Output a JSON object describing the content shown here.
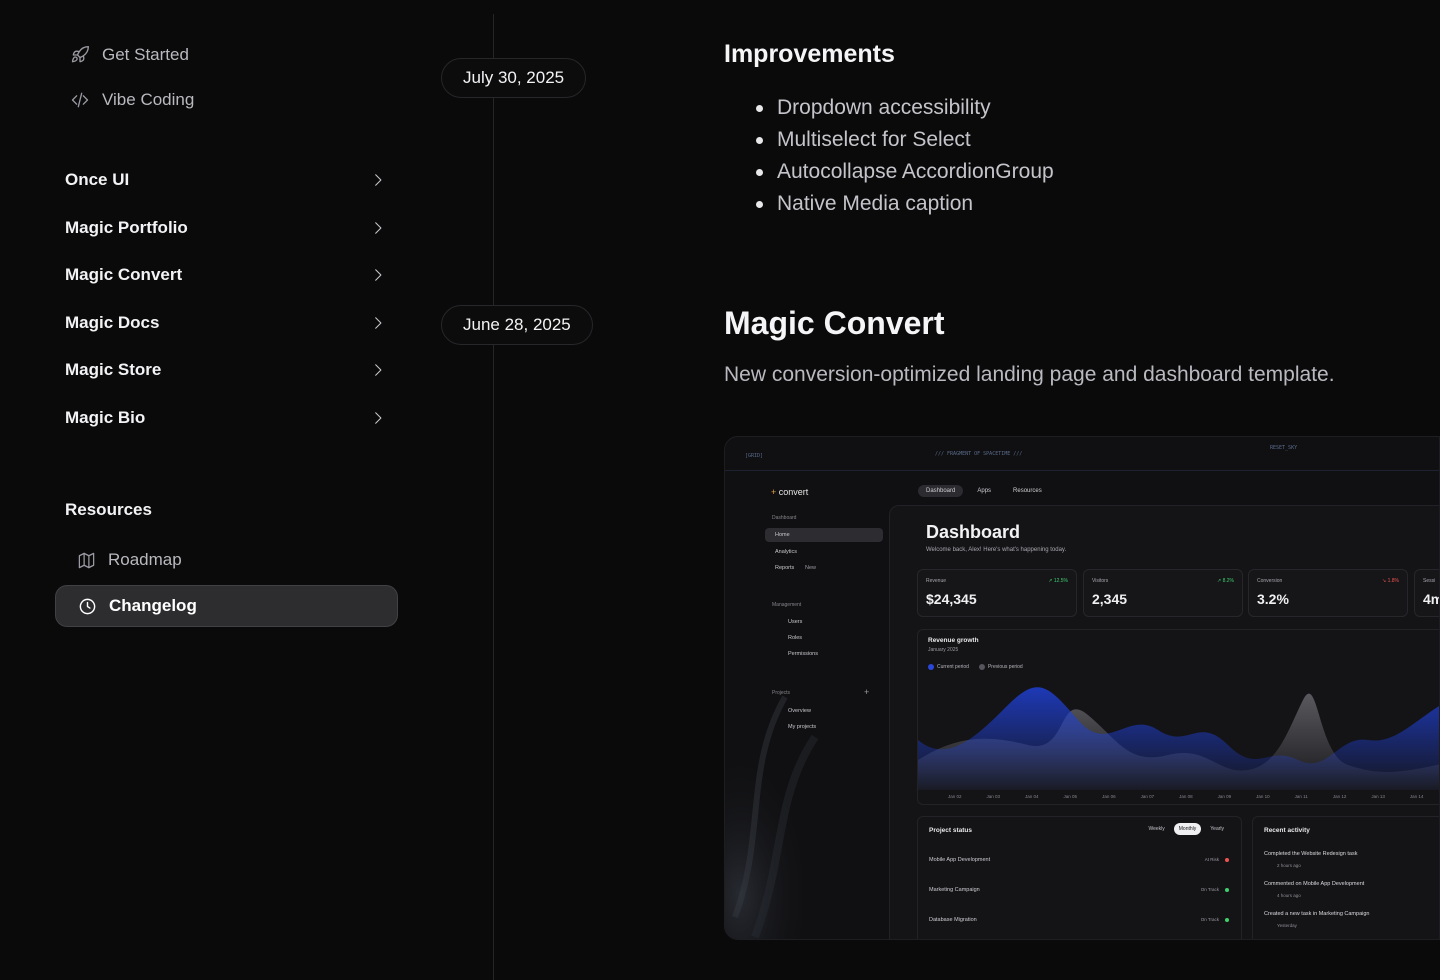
{
  "sidebar": {
    "top_links": [
      {
        "label": "Get Started",
        "icon": "rocket-icon"
      },
      {
        "label": "Vibe Coding",
        "icon": "code-icon"
      }
    ],
    "groups": [
      {
        "label": "Once UI"
      },
      {
        "label": "Magic Portfolio"
      },
      {
        "label": "Magic Convert"
      },
      {
        "label": "Magic Docs"
      },
      {
        "label": "Magic Store"
      },
      {
        "label": "Magic Bio"
      }
    ],
    "resources_title": "Resources",
    "resources": [
      {
        "label": "Roadmap",
        "icon": "map-icon"
      },
      {
        "label": "Changelog",
        "icon": "clock-icon",
        "active": true
      }
    ]
  },
  "timeline": {
    "entries": [
      {
        "date": "July 30, 2025",
        "heading": "Improvements",
        "bullets": [
          "Dropdown accessibility",
          "Multiselect for Select",
          "Autocollapse AccordionGroup",
          "Native Media caption"
        ]
      },
      {
        "date": "June 28, 2025",
        "heading": "Magic Convert",
        "description": "New conversion-optimized landing page and dashboard template."
      }
    ]
  },
  "preview": {
    "topbar": {
      "left": "[GRID]",
      "center": "/// FRAGMENT OF SPACETIME ///",
      "right": "RESET_SKY"
    },
    "logo": "convert",
    "tabs": [
      "Dashboard",
      "Apps",
      "Resources"
    ],
    "side_sections": {
      "dashboard_title": "Dashboard",
      "dashboard_items": [
        "Home",
        "Analytics",
        "Reports"
      ],
      "reports_badge": "New",
      "management_title": "Management",
      "management_items": [
        "Users",
        "Roles",
        "Permissions"
      ],
      "projects_title": "Projects",
      "projects_items": [
        "Overview",
        "My projects"
      ]
    },
    "title": "Dashboard",
    "subtitle": "Welcome back, Alex! Here's what's happening today.",
    "stats": [
      {
        "label": "Revenue",
        "value": "$24,345",
        "change": "12.5%"
      },
      {
        "label": "Visitors",
        "value": "2,345",
        "change": "8.2%"
      },
      {
        "label": "Conversion",
        "value": "3.2%",
        "change": "1.8%"
      },
      {
        "label": "Sessi",
        "value": "4m"
      }
    ],
    "chart_title": "Revenue growth",
    "chart_sub": "January 2025",
    "legend": [
      "Current period",
      "Previous period"
    ],
    "xticks": [
      "Jan 02",
      "Jan 03",
      "Jan 04",
      "Jan 05",
      "Jan 06",
      "Jan 07",
      "Jan 08",
      "Jan 09",
      "Jan 10",
      "Jan 11",
      "Jan 12",
      "Jan 13",
      "Jan 14"
    ],
    "project_status": {
      "title": "Project status",
      "tabs": [
        "Weekly",
        "Monthly",
        "Yearly"
      ],
      "rows": [
        {
          "name": "Mobile App Development",
          "status": "At Risk",
          "color": "#ef5350"
        },
        {
          "name": "Marketing Campaign",
          "status": "On Track",
          "color": "#3ecf6e"
        },
        {
          "name": "Database Migration",
          "status": "On Track",
          "color": "#3ecf6e"
        }
      ]
    },
    "recent_activity": {
      "title": "Recent activity",
      "items": [
        {
          "text": "Completed the Website Redesign task",
          "time": "2 hours ago"
        },
        {
          "text": "Commented on Mobile App Development",
          "time": "4 hours ago"
        },
        {
          "text": "Created a new task in Marketing Campaign",
          "time": "Yesterday"
        }
      ]
    },
    "colors": {
      "current": "#1f3fd1",
      "previous": "#5a5a60"
    }
  }
}
